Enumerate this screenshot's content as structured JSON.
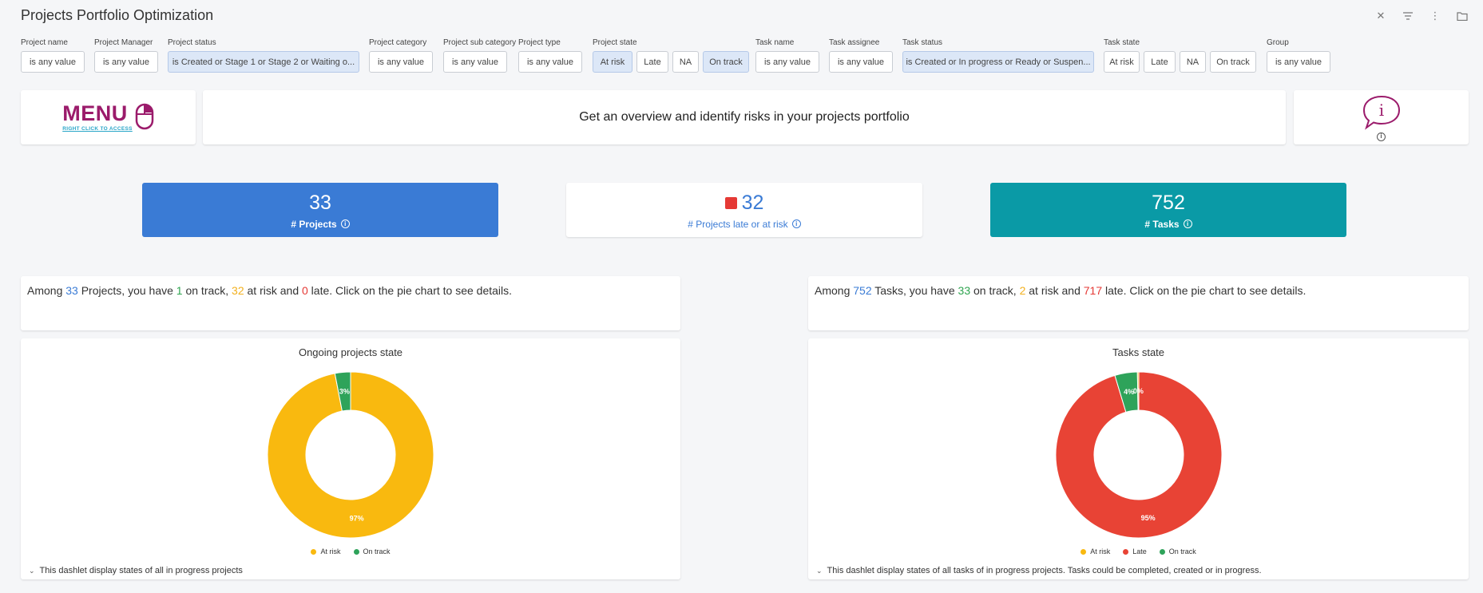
{
  "page": {
    "title": "Projects Portfolio Optimization"
  },
  "top_icons": [
    "close-icon",
    "filter-icon",
    "more-vert-icon",
    "folder-icon"
  ],
  "filters": [
    {
      "label": "Project name",
      "chips": [
        "is any value"
      ]
    },
    {
      "label": "Project Manager",
      "chips": [
        "is any value"
      ]
    },
    {
      "label": "Project status",
      "chips": [
        "is Created or Stage 1 or Stage 2 or Waiting o..."
      ],
      "selected": true
    },
    {
      "label": "Project category",
      "chips": [
        "is any value"
      ]
    },
    {
      "label": "Project sub category",
      "chips": [
        "is any value"
      ]
    },
    {
      "label": "Project type",
      "chips": [
        "is any value"
      ]
    },
    {
      "label": "Project state",
      "chips": [
        "At risk",
        "Late",
        "NA",
        "On track"
      ]
    },
    {
      "label": "Task name",
      "chips": [
        "is any value"
      ]
    },
    {
      "label": "Task assignee",
      "chips": [
        "is any value"
      ]
    },
    {
      "label": "Task status",
      "chips": [
        "is Created or In progress or Ready or Suspen..."
      ],
      "selected": true
    },
    {
      "label": "Task state",
      "chips": [
        "At risk",
        "Late",
        "NA",
        "On track"
      ]
    },
    {
      "label": "Group",
      "chips": [
        "is any value"
      ]
    }
  ],
  "menu": {
    "big": "MENU",
    "small": "RIGHT CLICK TO ACCESS"
  },
  "overview": {
    "text": "Get an overview and identify risks in your projects portfolio"
  },
  "info_card": {
    "icon_letter": "i"
  },
  "kpis": {
    "projects": {
      "value": "33",
      "label": "# Projects"
    },
    "late": {
      "value": "32",
      "label": "# Projects late or at risk"
    },
    "tasks": {
      "value": "752",
      "label": "# Tasks"
    }
  },
  "summary_projects": {
    "p1": "Among ",
    "total": "33",
    "p2": " Projects, you have ",
    "on_track": "1",
    "p3": " on track, ",
    "at_risk": "32",
    "p4": " at risk and ",
    "late": "0",
    "p5": " late. Click on the pie chart to see details."
  },
  "summary_tasks": {
    "p1": "Among ",
    "total": "752",
    "p2": " Tasks, you have ",
    "on_track": "33",
    "p3": " on track, ",
    "at_risk": "2",
    "p4": " at risk and ",
    "late": "717",
    "p5": " late. Click on the pie chart to see details."
  },
  "colors": {
    "at_risk": "#f9b90f",
    "late": "#e84335",
    "on_track": "#2ea35a",
    "blue": "#3a7bd5",
    "teal": "#0a9aa6"
  },
  "chart_data": [
    {
      "type": "pie",
      "title": "Ongoing projects state",
      "categories": [
        "At risk",
        "On track"
      ],
      "values": [
        32,
        1
      ],
      "labels": [
        "97%",
        "3%"
      ],
      "donut": true,
      "legend": "bottom",
      "footnote": "This dashlet display states of all in progress projects"
    },
    {
      "type": "pie",
      "title": "Tasks state",
      "categories": [
        "At risk",
        "Late",
        "On track"
      ],
      "values": [
        2,
        717,
        33
      ],
      "labels": [
        "0%",
        "95%",
        "4%"
      ],
      "donut": true,
      "legend": "bottom",
      "footnote": "This dashlet display states of all tasks of in progress projects. Tasks could be completed, created or in progress."
    }
  ]
}
